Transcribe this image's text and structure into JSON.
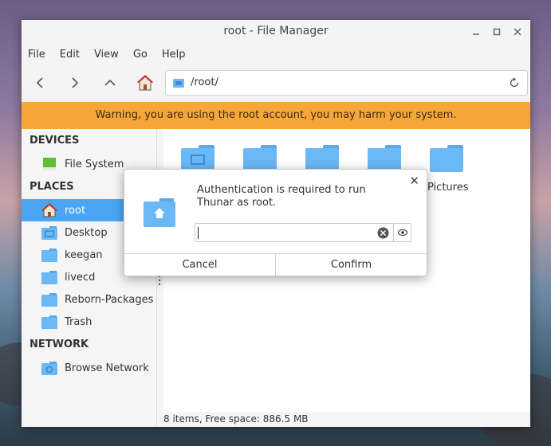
{
  "window": {
    "title": "root - File Manager"
  },
  "menubar": {
    "items": [
      "File",
      "Edit",
      "View",
      "Go",
      "Help"
    ]
  },
  "toolbar": {
    "back_icon": "chevron-left-icon",
    "forward_icon": "chevron-right-icon",
    "up_icon": "chevron-up-icon",
    "home_icon": "home-icon",
    "path": "/root/",
    "reload_icon": "reload-icon"
  },
  "warning": {
    "text": "Warning, you are using the root account, you may harm your system.",
    "color": "#f7a63a"
  },
  "sidebar": {
    "devices_header": "DEVICES",
    "devices": [
      {
        "label": "File System",
        "icon": "drive-icon"
      }
    ],
    "places_header": "PLACES",
    "places": [
      {
        "label": "root",
        "icon": "home-folder-icon",
        "active": true
      },
      {
        "label": "Desktop",
        "icon": "desktop-folder-icon"
      },
      {
        "label": "keegan",
        "icon": "folder-icon"
      },
      {
        "label": "livecd",
        "icon": "folder-icon"
      },
      {
        "label": "Reborn-Packages",
        "icon": "folder-icon"
      },
      {
        "label": "Trash",
        "icon": "trash-folder-icon"
      }
    ],
    "network_header": "NETWORK",
    "network": [
      {
        "label": "Browse Network",
        "icon": "network-folder-icon"
      }
    ],
    "accent": "#4aa6f3"
  },
  "content": {
    "visible_folder_label": "Pictures"
  },
  "statusbar": {
    "text": "8 items, Free space: 886.5 MB"
  },
  "dialog": {
    "message": "Authentication is required to run Thunar as root.",
    "password_value": "",
    "cancel_label": "Cancel",
    "confirm_label": "Confirm"
  }
}
